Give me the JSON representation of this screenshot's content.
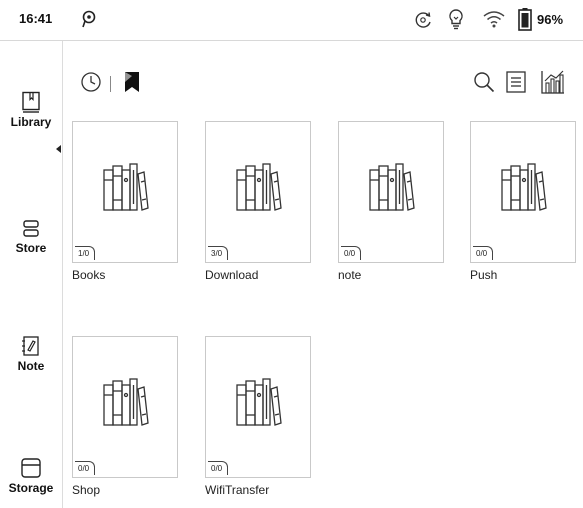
{
  "status": {
    "time": "16:41",
    "battery": "96%",
    "icons": [
      "pin-icon",
      "sync-icon",
      "lightbulb-icon",
      "wifi-icon",
      "battery-icon"
    ]
  },
  "sidebar": {
    "items": [
      {
        "label": "Library",
        "icon": "library-icon"
      },
      {
        "label": "Store",
        "icon": "store-icon"
      },
      {
        "label": "Note",
        "icon": "note-icon"
      },
      {
        "label": "Storage",
        "icon": "storage-icon"
      }
    ]
  },
  "toolbar": {
    "icons": [
      "history-icon",
      "bookmark-icon",
      "search-icon",
      "list-view-icon",
      "stats-icon"
    ]
  },
  "folders": [
    {
      "name": "Books",
      "count": "1/0"
    },
    {
      "name": "Download",
      "count": "3/0"
    },
    {
      "name": "note",
      "count": "0/0"
    },
    {
      "name": "Push",
      "count": "0/0"
    },
    {
      "name": "Shop",
      "count": "0/0"
    },
    {
      "name": "WifiTransfer",
      "count": "0/0"
    }
  ]
}
